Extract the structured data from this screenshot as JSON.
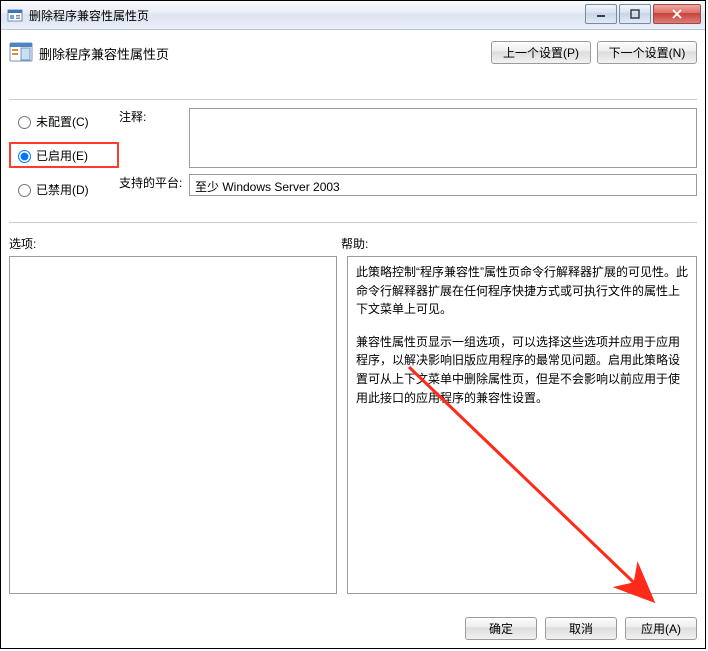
{
  "window": {
    "title": "删除程序兼容性属性页"
  },
  "header": {
    "title": "删除程序兼容性属性页",
    "prev_btn": "上一个设置(P)",
    "next_btn": "下一个设置(N)"
  },
  "radios": {
    "not_configured": "未配置(C)",
    "enabled": "已启用(E)",
    "disabled": "已禁用(D)",
    "selected": "enabled"
  },
  "comment": {
    "label": "注释:",
    "value": ""
  },
  "support": {
    "label": "支持的平台:",
    "value": "至少 Windows Server 2003"
  },
  "options_label": "选项:",
  "help_label": "帮助:",
  "help_paragraphs": [
    "此策略控制“程序兼容性”属性页命令行解释器扩展的可见性。此命令行解释器扩展在任何程序快捷方式或可执行文件的属性上下文菜单上可见。",
    "兼容性属性页显示一组选项，可以选择这些选项并应用于应用程序，以解决影响旧版应用程序的最常见问题。启用此策略设置可从上下文菜单中删除属性页，但是不会影响以前应用于使用此接口的应用程序的兼容性设置。"
  ],
  "buttons": {
    "ok": "确定",
    "cancel": "取消",
    "apply": "应用(A)"
  }
}
